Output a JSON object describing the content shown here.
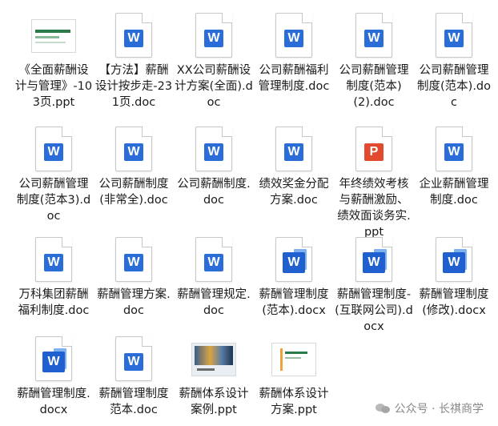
{
  "files": [
    {
      "name": "《全面薪酬设计与管理》-103页.ppt",
      "icon": "ppt-thumbnail-green"
    },
    {
      "name": "【方法】薪酬设计按步走-231页.doc",
      "icon": "word-doc-icon"
    },
    {
      "name": "XX公司薪酬设计方案(全面).doc",
      "icon": "word-doc-icon"
    },
    {
      "name": "公司薪酬福利管理制度.doc",
      "icon": "word-doc-icon"
    },
    {
      "name": "公司薪酬管理制度(范本) (2).doc",
      "icon": "word-doc-icon"
    },
    {
      "name": "公司薪酬管理制度(范本).doc",
      "icon": "word-doc-icon"
    },
    {
      "name": "公司薪酬管理制度(范本3).doc",
      "icon": "word-doc-icon"
    },
    {
      "name": "公司薪酬制度(非常全).doc",
      "icon": "word-doc-icon"
    },
    {
      "name": "公司薪酬制度.doc",
      "icon": "word-doc-icon"
    },
    {
      "name": "绩效奖金分配方案.doc",
      "icon": "word-doc-icon"
    },
    {
      "name": "年终绩效考核与薪酬激励、绩效面谈务实.ppt",
      "icon": "powerpoint-icon"
    },
    {
      "name": "企业薪酬管理制度.doc",
      "icon": "word-doc-icon"
    },
    {
      "name": "万科集团薪酬福利制度.doc",
      "icon": "word-doc-icon"
    },
    {
      "name": "薪酬管理方案.doc",
      "icon": "word-doc-icon"
    },
    {
      "name": "薪酬管理规定.doc",
      "icon": "word-doc-icon"
    },
    {
      "name": "薪酬管理制度(范本).docx",
      "icon": "word-docx-icon"
    },
    {
      "name": "薪酬管理制度-(互联网公司).docx",
      "icon": "word-docx-icon"
    },
    {
      "name": "薪酬管理制度(修改).docx",
      "icon": "word-docx-icon"
    },
    {
      "name": "薪酬管理制度.docx",
      "icon": "word-docx-icon"
    },
    {
      "name": "薪酬管理制度范本.doc",
      "icon": "word-doc-icon"
    },
    {
      "name": "薪酬体系设计案例.ppt",
      "icon": "ppt-thumbnail-photo"
    },
    {
      "name": "薪酬体系设计方案.ppt",
      "icon": "ppt-thumbnail-orange"
    }
  ],
  "glyphs": {
    "word": "W",
    "ppt": "P"
  },
  "watermark": {
    "text": "公众号 · 长祺商学"
  }
}
